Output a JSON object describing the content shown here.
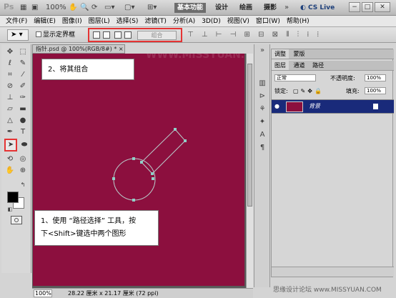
{
  "app": {
    "logo": "Ps",
    "workspaces": [
      "基本功能",
      "设计",
      "绘画",
      "摄影"
    ],
    "active_workspace": "基本功能",
    "cs_live": "CS Live"
  },
  "menu": [
    "文件(F)",
    "编辑(E)",
    "图像(I)",
    "图层(L)",
    "选择(S)",
    "滤镜(T)",
    "分析(A)",
    "3D(D)",
    "视图(V)",
    "窗口(W)",
    "帮助(H)"
  ],
  "options": {
    "show_bounds_label": "显示定界框",
    "combine_label": "组合"
  },
  "document": {
    "tab_title": "指针.psd @ 100%(RGB/8#) *",
    "zoom": "100%",
    "doc_info": "28.22 厘米 x 21.17 厘米 (72 ppi)",
    "watermark": "WWW.MISSYUAN.COM"
  },
  "callouts": {
    "step2": "2、将其组合",
    "step1_line1": "1、使用 “路径选择” 工具，按",
    "step1_line2": "下<Shift>键选中两个图形"
  },
  "panel": {
    "top_tabs": [
      "调整",
      "蒙版"
    ],
    "layer_tabs": [
      "图层",
      "通道",
      "路径"
    ],
    "blend_mode": "正常",
    "opacity_label": "不透明度:",
    "opacity_value": "100%",
    "lock_label": "锁定:",
    "fill_label": "填充:",
    "fill_value": "100%",
    "layer_name": "背景"
  },
  "footer_brand": "思缘设计论坛  www.MISSYUAN.COM",
  "colors": {
    "canvas": "#8c0f3e",
    "highlight": "#e53333",
    "layer_selected": "#192a7a"
  }
}
